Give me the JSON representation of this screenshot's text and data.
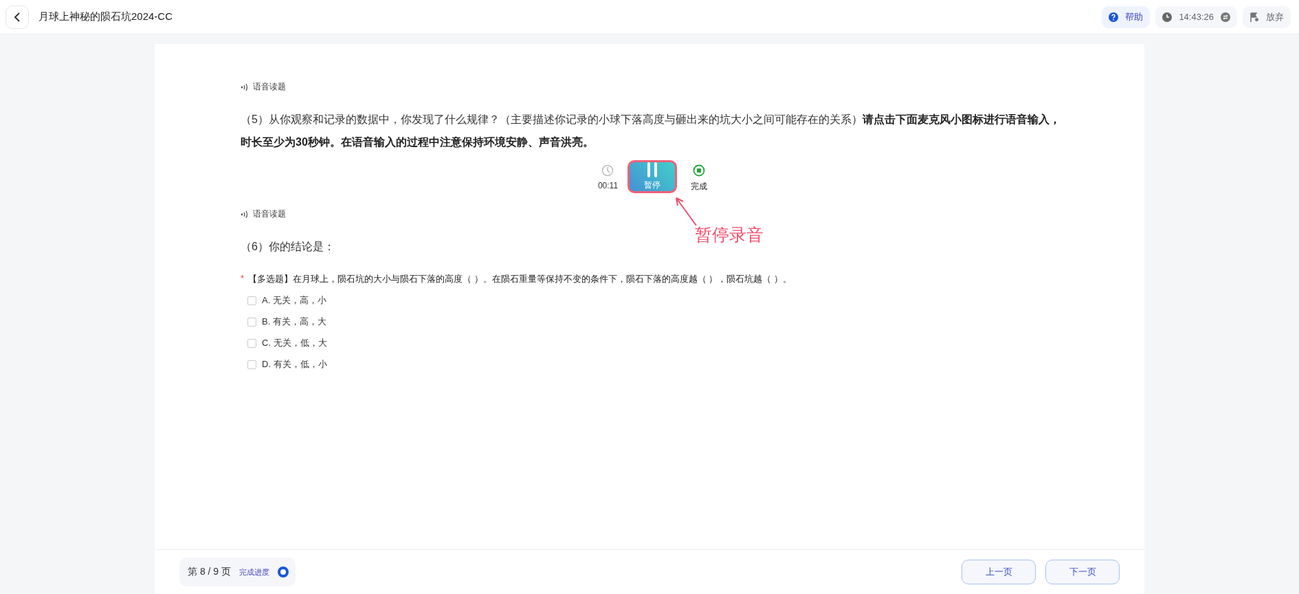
{
  "header": {
    "title": "月球上神秘的陨石坑2024-CC",
    "help": "帮助",
    "time": "14:43:26",
    "quit": "放弃"
  },
  "sections": [
    {
      "read_aloud": "语音读题",
      "question": "（5）从你观察和记录的数据中，你发现了什么规律？（主要描述你记录的小球下落高度与砸出来的坑大小之间可能存在的关系）**请点击下面麦克风小图标进行语音输入，时长至少为30秒钟。在语音输入的过程中注意保持环境安静、声音洪亮。**",
      "recorder": {
        "elapsed": "00:11",
        "pause": "暂停",
        "done": "完成",
        "annotation": "暂停录音"
      }
    },
    {
      "read_aloud": "语音读题",
      "question": "（6）你的结论是：",
      "choice": {
        "required_mark": "*",
        "prompt": "【多选题】在月球上，陨石坑的大小与陨石下落的高度（ ）。在陨石重量等保持不变的条件下，陨石下落的高度越（ ），陨石坑越（ ）。",
        "options": [
          {
            "label": "A. 无关，高，小",
            "checked": false
          },
          {
            "label": "B. 有关，高，大",
            "checked": false
          },
          {
            "label": "C. 无关，低，大",
            "checked": false
          },
          {
            "label": "D. 有关，低，小",
            "checked": false
          }
        ]
      }
    }
  ],
  "footer": {
    "page": "第 8 / 9 页",
    "progress": "完成进度",
    "prev": "上一页",
    "next": "下一页"
  }
}
